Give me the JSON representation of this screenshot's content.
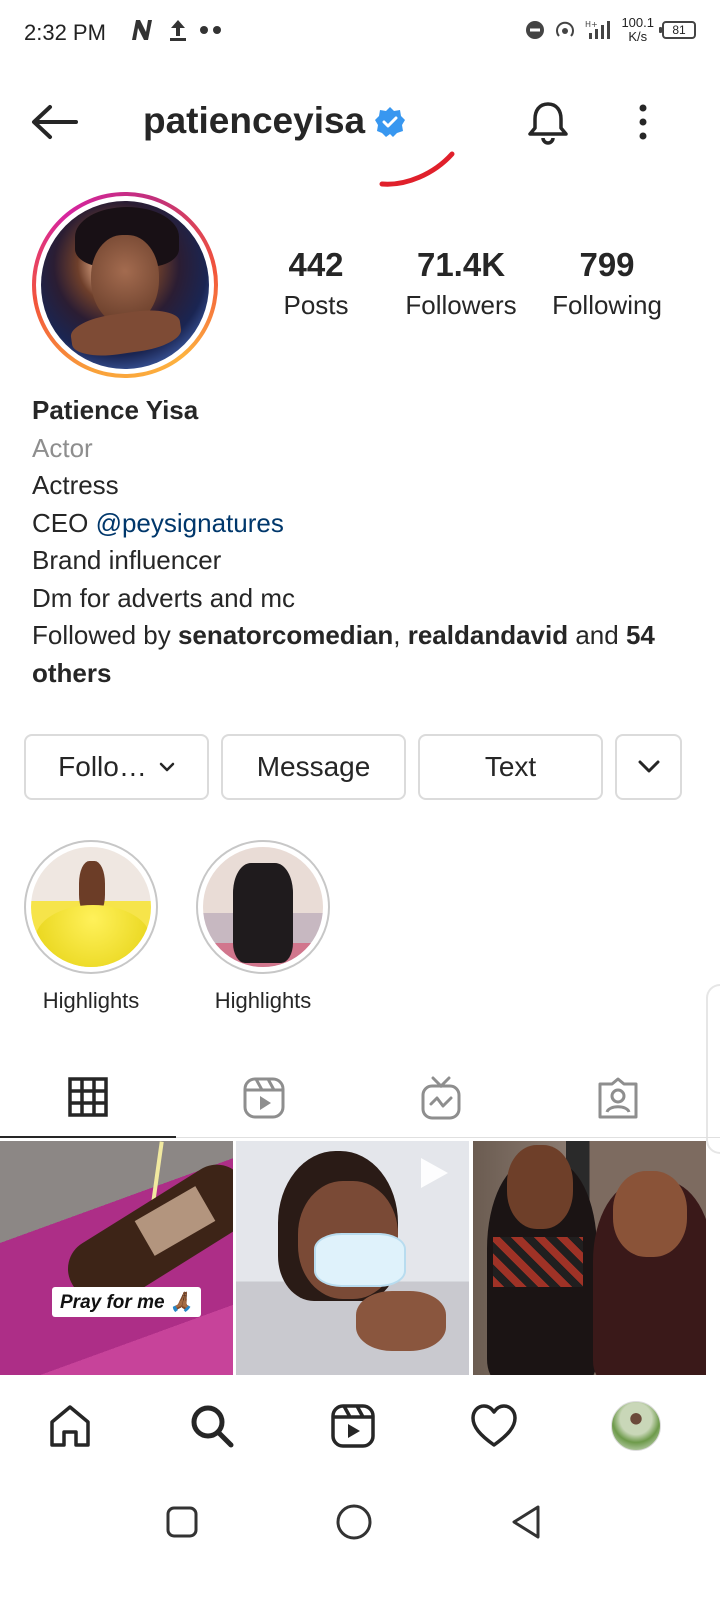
{
  "status_bar": {
    "time": "2:32 PM",
    "net_speed_value": "100.1",
    "net_speed_unit": "K/s",
    "battery": "81"
  },
  "header": {
    "username": "patienceyisa",
    "verified": true,
    "icons": [
      "arrow-left-icon",
      "verified-badge-icon",
      "bell-icon",
      "more-vertical-icon"
    ]
  },
  "profile": {
    "stats": {
      "posts_count": "442",
      "posts_label": "Posts",
      "followers_count": "71.4K",
      "followers_label": "Followers",
      "following_count": "799",
      "following_label": "Following"
    },
    "bio": {
      "name": "Patience Yisa",
      "category": "Actor",
      "line1": "Actress",
      "line2_prefix": "CEO ",
      "line2_link": "@peysignatures",
      "line3": "Brand influencer",
      "line4": "Dm for adverts and mc",
      "followed_by_prefix": "Followed by ",
      "followed_by_user1": "senatorcomedian",
      "followed_by_sep": ", ",
      "followed_by_user2": "realdandavid",
      "followed_by_and": " and ",
      "followed_by_others": "54 others"
    }
  },
  "actions": {
    "following_label": "Follo…",
    "message_label": "Message",
    "text_label": "Text"
  },
  "highlights": [
    {
      "label": "Highlights"
    },
    {
      "label": "Highlights"
    }
  ],
  "tabs": [
    "grid-icon",
    "reels-icon",
    "igtv-icon",
    "tagged-icon"
  ],
  "posts": [
    {
      "overlay_text": "Pray for me 🙏🏾"
    },
    {
      "type": "video"
    },
    {
      "type": "photo"
    }
  ],
  "bottom_nav": [
    "home-icon",
    "search-icon",
    "reels-icon",
    "heart-icon",
    "profile-avatar"
  ],
  "colors": {
    "link": "#00376b",
    "verified": "#3897f0",
    "annotation_red": "#e0202b",
    "secondary_text": "#8e8e8e"
  }
}
